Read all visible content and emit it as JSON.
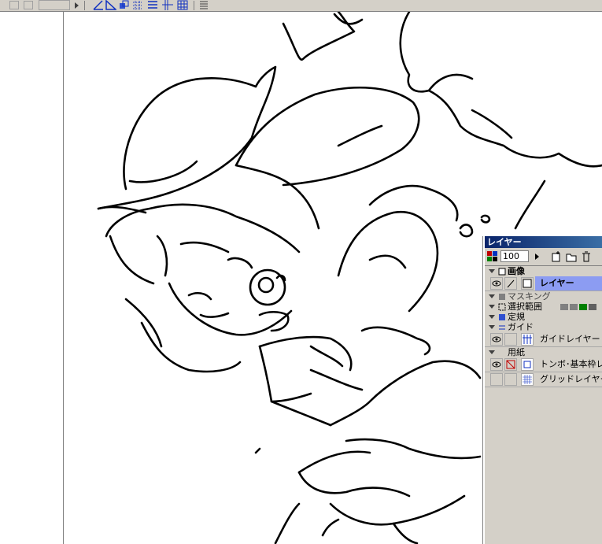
{
  "toolbar": {
    "icons": [
      "pen-ruler-icon",
      "triangle-ruler-icon",
      "copy-layer-icon",
      "grid-settings-icon",
      "guide-icon",
      "crosshair-icon",
      "grid-icon",
      "menu-icon"
    ]
  },
  "layers": {
    "title": "レイヤー",
    "opacity": "100",
    "groups": [
      {
        "label": "画像"
      },
      {
        "label": "マスキング"
      },
      {
        "label": "選択範囲"
      },
      {
        "label": "定規"
      },
      {
        "label": "ガイド"
      },
      {
        "label": "用紙"
      }
    ],
    "items": {
      "layer": "レイヤー",
      "guide_layer": "ガイドレイヤー",
      "tombo_layer": "トンボ･基本枠レ",
      "grid_layer": "グリッドレイヤー"
    }
  },
  "colors": {
    "selected_row": "#8c9cf2",
    "titlebar": "#0a246a",
    "panel_bg": "#d4d0c8"
  }
}
